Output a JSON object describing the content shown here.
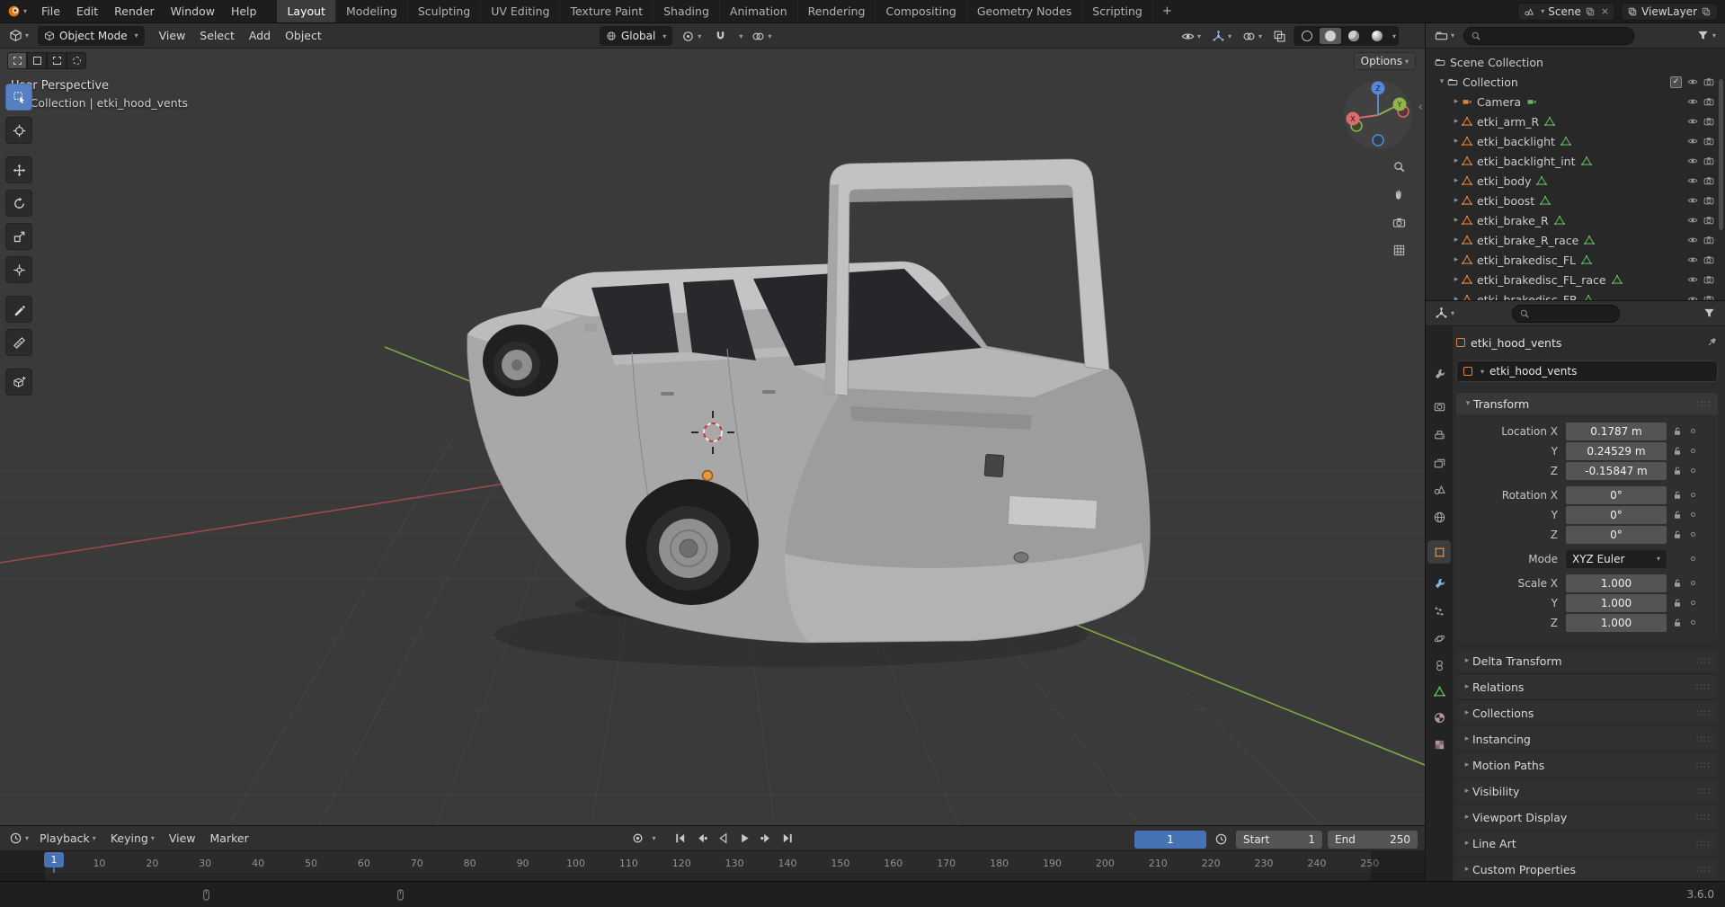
{
  "topbar": {
    "menus": [
      "File",
      "Edit",
      "Render",
      "Window",
      "Help"
    ],
    "workspaces": [
      {
        "label": "Layout",
        "active": true
      },
      {
        "label": "Modeling",
        "active": false
      },
      {
        "label": "Sculpting",
        "active": false
      },
      {
        "label": "UV Editing",
        "active": false
      },
      {
        "label": "Texture Paint",
        "active": false
      },
      {
        "label": "Shading",
        "active": false
      },
      {
        "label": "Animation",
        "active": false
      },
      {
        "label": "Rendering",
        "active": false
      },
      {
        "label": "Compositing",
        "active": false
      },
      {
        "label": "Geometry Nodes",
        "active": false
      },
      {
        "label": "Scripting",
        "active": false
      }
    ],
    "add_workspace": "+",
    "scene_selector": "Scene",
    "view_layer_selector": "ViewLayer"
  },
  "tool_header": {
    "mode": "Object Mode",
    "menus": [
      "View",
      "Select",
      "Add",
      "Object"
    ],
    "orientation": "Global"
  },
  "viewport": {
    "options_label": "Options",
    "perspective_label": "User Perspective",
    "context_label": "(1) Collection | etki_hood_vents",
    "gizmo": {
      "x": "X",
      "y": "Y",
      "z": "Z"
    }
  },
  "outliner": {
    "scene_collection": "Scene Collection",
    "collection": "Collection",
    "objects": [
      {
        "name": "Camera",
        "is_camera": true
      },
      {
        "name": "etki_arm_R",
        "is_camera": false
      },
      {
        "name": "etki_backlight",
        "is_camera": false
      },
      {
        "name": "etki_backlight_int",
        "is_camera": false
      },
      {
        "name": "etki_body",
        "is_camera": false
      },
      {
        "name": "etki_boost",
        "is_camera": false
      },
      {
        "name": "etki_brake_R",
        "is_camera": false
      },
      {
        "name": "etki_brake_R_race",
        "is_camera": false
      },
      {
        "name": "etki_brakedisc_FL",
        "is_camera": false
      },
      {
        "name": "etki_brakedisc_FL_race",
        "is_camera": false
      },
      {
        "name": "etki_brakedisc_FR",
        "is_camera": false
      }
    ]
  },
  "properties": {
    "breadcrumb": "etki_hood_vents",
    "name_field": "etki_hood_vents",
    "transform": {
      "title": "Transform",
      "location": [
        {
          "label": "Location X",
          "value": "0.1787 m"
        },
        {
          "label": "Y",
          "value": "0.24529 m"
        },
        {
          "label": "Z",
          "value": "-0.15847 m"
        }
      ],
      "rotation": [
        {
          "label": "Rotation X",
          "value": "0°"
        },
        {
          "label": "Y",
          "value": "0°"
        },
        {
          "label": "Z",
          "value": "0°"
        }
      ],
      "mode_label": "Mode",
      "mode_value": "XYZ Euler",
      "scale": [
        {
          "label": "Scale X",
          "value": "1.000"
        },
        {
          "label": "Y",
          "value": "1.000"
        },
        {
          "label": "Z",
          "value": "1.000"
        }
      ]
    },
    "sections": [
      "Delta Transform",
      "Relations",
      "Collections",
      "Instancing",
      "Motion Paths",
      "Visibility",
      "Viewport Display",
      "Line Art",
      "Custom Properties"
    ]
  },
  "timeline": {
    "menus": [
      {
        "label": "Playback",
        "caret": true
      },
      {
        "label": "Keying",
        "caret": true
      },
      {
        "label": "View",
        "caret": false
      },
      {
        "label": "Marker",
        "caret": false
      }
    ],
    "current_frame": "1",
    "start_label": "Start",
    "start_value": "1",
    "end_label": "End",
    "end_value": "250",
    "playhead": "1",
    "ticks": [
      "10",
      "20",
      "30",
      "40",
      "50",
      "60",
      "70",
      "80",
      "90",
      "100",
      "110",
      "120",
      "130",
      "140",
      "150",
      "160",
      "170",
      "180",
      "190",
      "200",
      "210",
      "220",
      "230",
      "240",
      "250"
    ]
  },
  "statusbar": {
    "version": "3.6.0"
  },
  "colors": {
    "accent_blue": "#4772b3",
    "object_orange": "#e0863c",
    "data_green": "#60b75f",
    "axis_x_red": "#a2494d",
    "axis_y_green": "#83b044"
  },
  "icons": {
    "search": "magnifier",
    "filter": "funnel",
    "visibility": "eye",
    "render_visibility": "camera",
    "mesh": "orange-triangle",
    "mesh_data": "green-triangle",
    "collection": "box",
    "clock": "clock",
    "snap": "magnet",
    "orientation": "globe",
    "lock": "padlock",
    "pin": "pushpin"
  }
}
